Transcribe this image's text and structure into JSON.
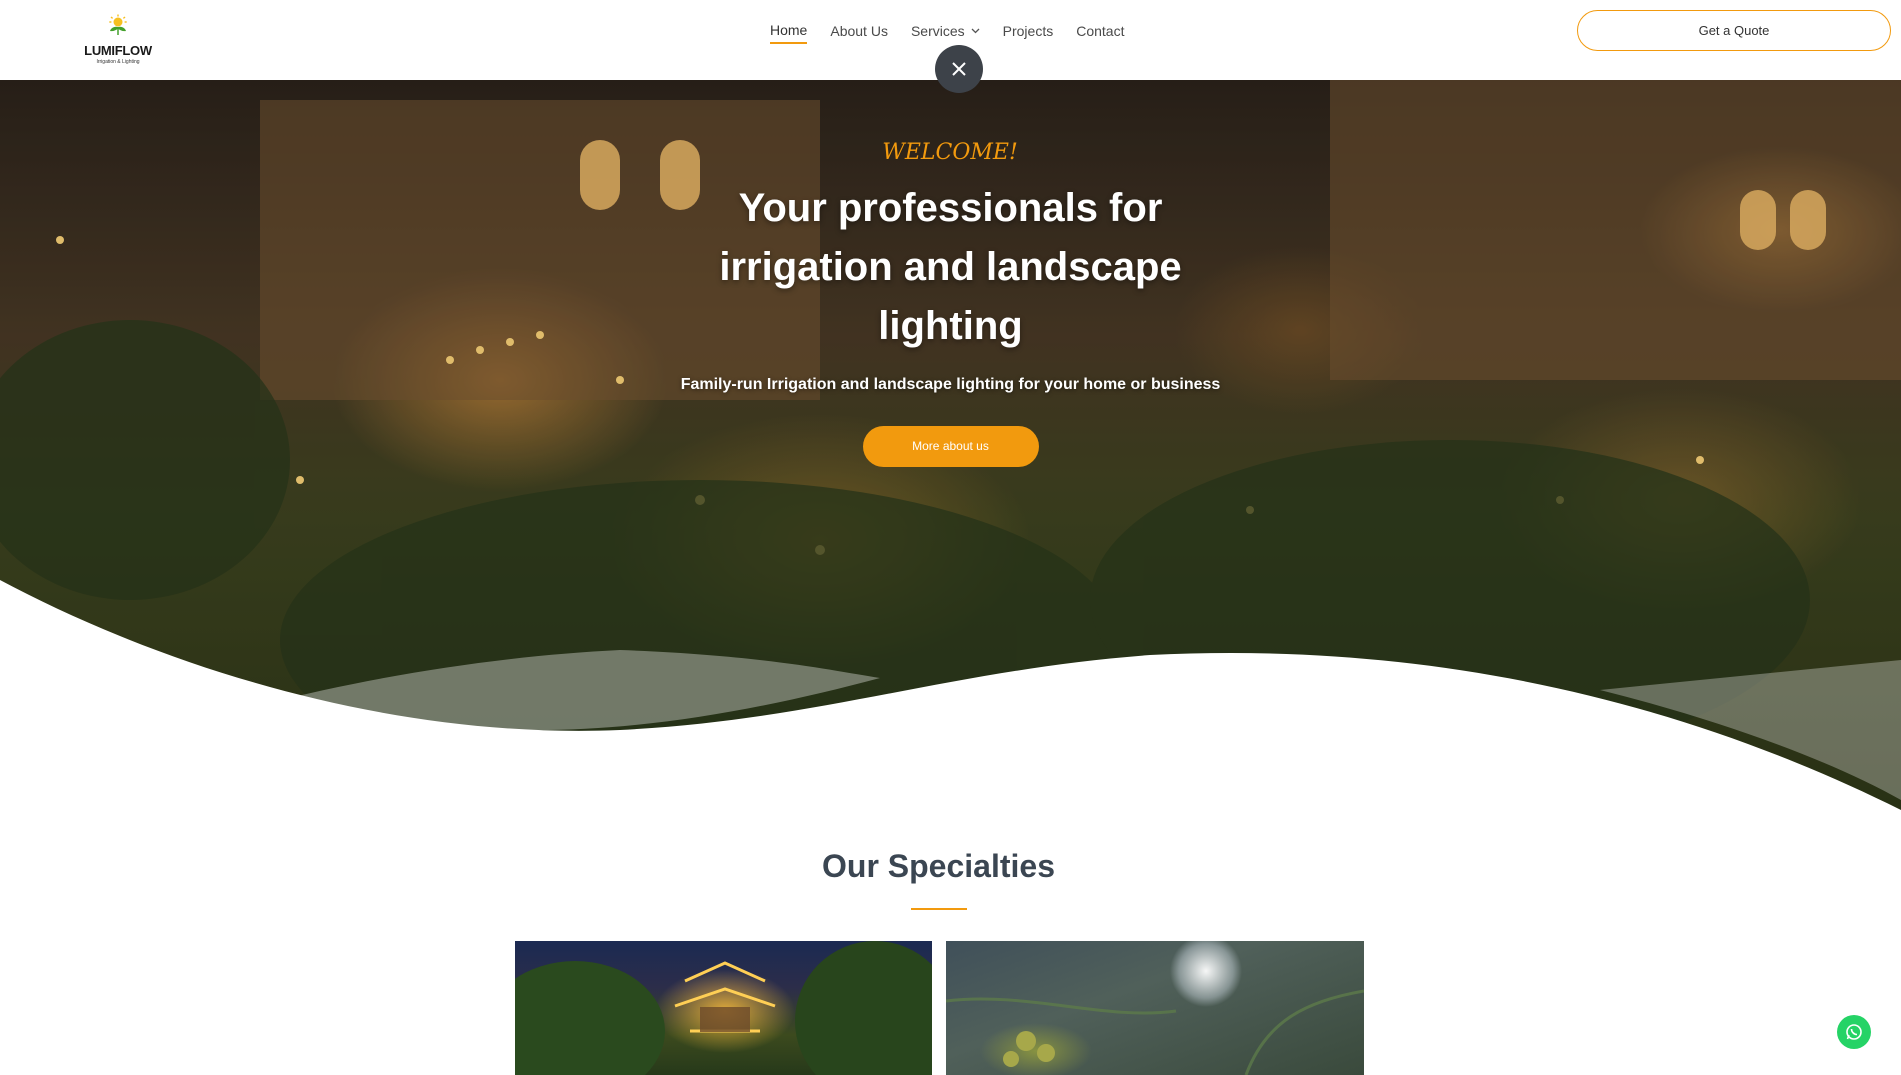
{
  "brand": {
    "name": "LUMIFLOW",
    "tagline": "Irrigation & Lighting",
    "accent": "#f29a0e"
  },
  "nav": {
    "items": [
      {
        "label": "Home"
      },
      {
        "label": "About Us"
      },
      {
        "label": "Services"
      },
      {
        "label": "Projects"
      },
      {
        "label": "Contact"
      }
    ],
    "active": "Home",
    "quote_label": "Get a Quote"
  },
  "hero": {
    "welcome": "WELCOME!",
    "headline": "Your professionals for irrigation and landscape lighting",
    "tagline": "Family-run Irrigation and landscape lighting for your home or business",
    "cta_label": "More about us"
  },
  "specialties": {
    "title": "Our Specialties"
  },
  "icons": {
    "close": "close-icon",
    "whatsapp": "whatsapp-icon",
    "services_dropdown": "chevron-down-icon"
  }
}
